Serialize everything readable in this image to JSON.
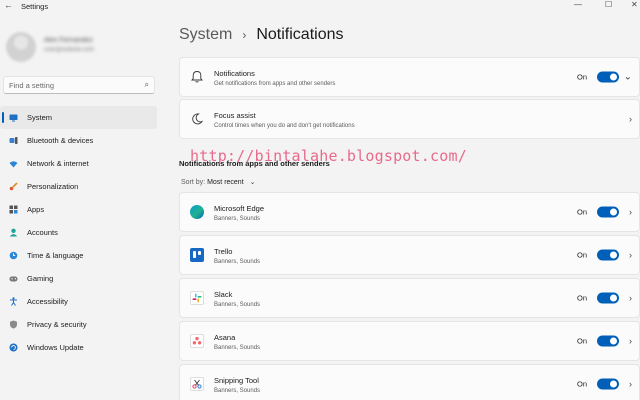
{
  "window": {
    "title": "Settings",
    "back_icon": "back-arrow-icon",
    "minimize_glyph": "—",
    "maximize_glyph": "☐",
    "close_glyph": "✕"
  },
  "sidebar": {
    "profile": {
      "name": "Alex Fernandez",
      "email": "user@outlook.com"
    },
    "search": {
      "placeholder": "Find a setting"
    },
    "items": [
      {
        "label": "System",
        "icon": "system-icon",
        "active": true
      },
      {
        "label": "Bluetooth & devices",
        "icon": "bluetooth-icon"
      },
      {
        "label": "Network & internet",
        "icon": "network-icon"
      },
      {
        "label": "Personalization",
        "icon": "brush-icon"
      },
      {
        "label": "Apps",
        "icon": "apps-icon"
      },
      {
        "label": "Accounts",
        "icon": "accounts-icon"
      },
      {
        "label": "Time & language",
        "icon": "globe-clock-icon"
      },
      {
        "label": "Gaming",
        "icon": "gaming-icon"
      },
      {
        "label": "Accessibility",
        "icon": "accessibility-icon"
      },
      {
        "label": "Privacy & security",
        "icon": "shield-icon"
      },
      {
        "label": "Windows Update",
        "icon": "update-icon"
      }
    ]
  },
  "main": {
    "breadcrumb": {
      "parent": "System",
      "separator": "›",
      "current": "Notifications"
    },
    "notifications_card": {
      "title": "Notifications",
      "subtitle": "Get notifications from apps and other senders",
      "toggle_label": "On",
      "toggle_on": true,
      "expand_glyph": "⌄"
    },
    "focus_card": {
      "title": "Focus assist",
      "subtitle": "Control times when you do and don't get notifications",
      "chevron": "›"
    },
    "section_title": "Notifications from apps and other senders",
    "sort": {
      "label": "Sort by:",
      "value": "Most recent",
      "chevron": "⌄"
    },
    "apps": [
      {
        "name": "Microsoft Edge",
        "detail": "Banners, Sounds",
        "toggle_label": "On",
        "icon": "edge-icon"
      },
      {
        "name": "Trello",
        "detail": "Banners, Sounds",
        "toggle_label": "On",
        "icon": "trello-icon"
      },
      {
        "name": "Slack",
        "detail": "Banners, Sounds",
        "toggle_label": "On",
        "icon": "slack-icon"
      },
      {
        "name": "Asana",
        "detail": "Banners, Sounds",
        "toggle_label": "On",
        "icon": "asana-icon"
      },
      {
        "name": "Snipping Tool",
        "detail": "Banners, Sounds",
        "toggle_label": "On",
        "icon": "snipping-tool-icon"
      }
    ],
    "row_chevron": "›"
  },
  "watermark": "http://bintalahe.blogspot.com/",
  "colors": {
    "accent": "#005fb8",
    "watermark": "#e86a8c"
  }
}
